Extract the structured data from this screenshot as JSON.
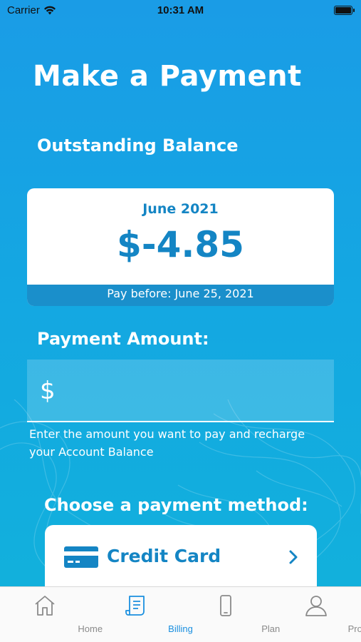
{
  "status_bar": {
    "carrier": "Carrier",
    "time": "10:31 AM"
  },
  "page": {
    "title": "Make a Payment"
  },
  "balance": {
    "section_title": "Outstanding Balance",
    "month": "June 2021",
    "amount": "$-4.85",
    "due_text": "Pay before: June 25, 2021"
  },
  "payment_amount": {
    "section_title": "Payment Amount:",
    "currency_symbol": "$",
    "value": "",
    "helper_text": "Enter the amount you want to pay and recharge your Account Balance"
  },
  "payment_method": {
    "section_title": "Choose a payment method:",
    "options": [
      {
        "label": "Credit Card",
        "icon": "credit-card-icon"
      }
    ]
  },
  "tab_bar": {
    "items": [
      {
        "label": "Home",
        "icon": "home-icon",
        "active": false
      },
      {
        "label": "Billing",
        "icon": "billing-icon",
        "active": true
      },
      {
        "label": "Plan",
        "icon": "phone-icon",
        "active": false
      },
      {
        "label": "Profile",
        "icon": "profile-icon",
        "active": false
      }
    ]
  },
  "colors": {
    "background_top": "#1a9ce6",
    "background_bottom": "#11b2db",
    "accent": "#1485c4",
    "tab_active": "#1a8fdf",
    "tab_inactive": "#8a8a8a"
  }
}
